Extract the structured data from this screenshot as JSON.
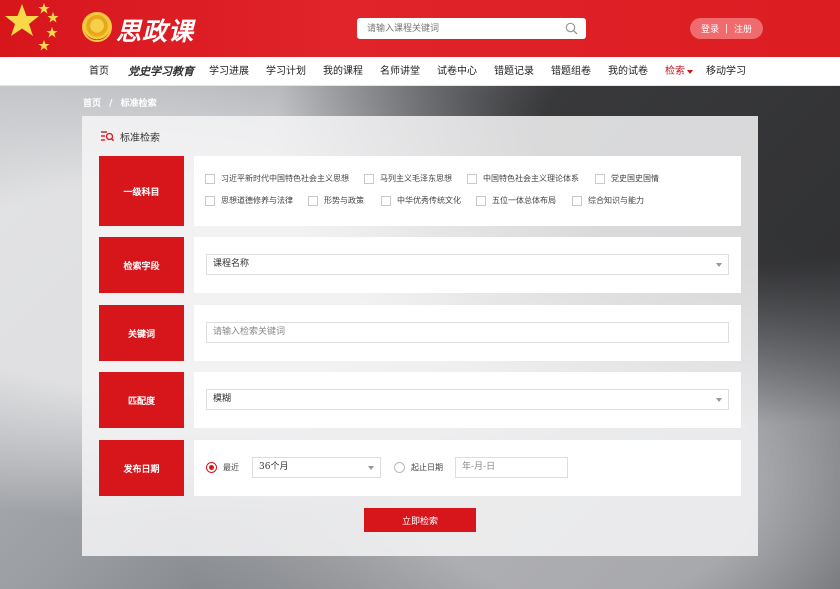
{
  "header": {
    "logo_text": "思政课",
    "search_placeholder": "请输入课程关键词",
    "login_label": "登录",
    "separator": "|",
    "register_label": "注册"
  },
  "nav": {
    "items": [
      "首页",
      "党史学习教育",
      "学习进展",
      "学习计划",
      "我的课程",
      "名师讲堂",
      "试卷中心",
      "错题记录",
      "错题组卷",
      "我的试卷",
      "检索",
      "移动学习"
    ],
    "active_index": 10
  },
  "breadcrumb": {
    "home": "首页",
    "sep": "/",
    "current": "标准检索"
  },
  "panel": {
    "title": "标准检索",
    "subject": {
      "label": "一级科目",
      "options": [
        "习近平新时代中国特色社会主义思想",
        "马列主义毛泽东思想",
        "中国特色社会主义理论体系",
        "党史国史国情",
        "思想道德修养与法律",
        "形势与政策",
        "中华优秀传统文化",
        "五位一体总体布局",
        "综合知识与能力"
      ]
    },
    "field": {
      "label": "检索字段",
      "value": "课程名称"
    },
    "keyword": {
      "label": "关键词",
      "placeholder": "请输入检索关键词"
    },
    "match": {
      "label": "匹配度",
      "value": "模糊"
    },
    "date": {
      "label": "发布日期",
      "recent_label": "最近",
      "recent_value": "36个月",
      "range_label": "起止日期",
      "range_placeholder": "年-月-日"
    },
    "submit_label": "立即检索"
  },
  "colors": {
    "brand_red": "#d7161c",
    "pill": "#ef6b6e"
  }
}
